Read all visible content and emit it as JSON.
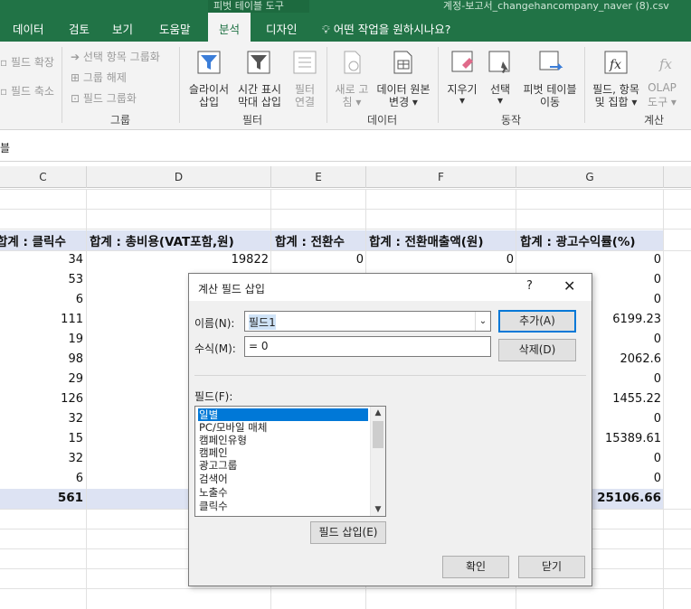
{
  "ribbon": {
    "context_title": "피벗 테이블 도구",
    "file_title": "계정-보고서_changehancompany_naver (8).csv",
    "tabs": [
      "데이터",
      "검토",
      "보기",
      "도움말",
      "분석",
      "디자인"
    ],
    "active_tab": "분석",
    "tell_me": "어떤 작업을 원하시나요?",
    "left_items": {
      "expand": "필드 확장",
      "collapse": "필드 축소"
    },
    "group_group": {
      "label": "그룹",
      "items": [
        "선택 항목 그룹화",
        "그룹 해제",
        "필드 그룹화"
      ]
    },
    "filter_group": {
      "label": "필터",
      "slicer": [
        "슬라이서",
        "삽입"
      ],
      "timeline": [
        "시간 표시",
        "막대 삽입"
      ],
      "filter_conn": [
        "필터",
        "연결"
      ]
    },
    "data_group": {
      "label": "데이터",
      "refresh": [
        "새로 고",
        "침 ▾"
      ],
      "change_source": [
        "데이터 원본",
        "변경 ▾"
      ]
    },
    "actions_group": {
      "label": "동작",
      "clear": [
        "지우기",
        "▾"
      ],
      "select": [
        "선택",
        "▾"
      ],
      "move": [
        "피벗 테이블",
        "이동"
      ]
    },
    "calc_group": {
      "label": "계산",
      "fields": [
        "필드, 항목",
        "및 집합 ▾"
      ],
      "olap": [
        "OLAP",
        "도구 ▾"
      ]
    }
  },
  "namebox_partial": "블",
  "columns": [
    "C",
    "D",
    "E",
    "F",
    "G"
  ],
  "pivot": {
    "headers": [
      "합계 : 클릭수",
      "합계 : 총비용(VAT포함,원)",
      "합계 : 전환수",
      "합계 : 전환매출액(원)",
      "합계 : 광고수익률(%)"
    ],
    "first_row": {
      "clicks": "34",
      "cost": "19822",
      "conv": "0",
      "revenue": "0",
      "roas": "0"
    },
    "clicks": [
      "53",
      "6",
      "111",
      "19",
      "98",
      "29",
      "126",
      "32",
      "15",
      "32",
      "6"
    ],
    "roas": [
      "0",
      "0",
      "6199.23",
      "0",
      "2062.6",
      "0",
      "1455.22",
      "0",
      "15389.61",
      "0",
      "0"
    ],
    "total_clicks": "561",
    "total_roas": "25106.66"
  },
  "dialog": {
    "title": "계산 필드 삽입",
    "help": "?",
    "close": "✕",
    "name_label": "이름(N):",
    "name_value": "필드1",
    "formula_label": "수식(M):",
    "formula_value": "= 0",
    "add_button": "추가(A)",
    "delete_button": "삭제(D)",
    "fields_label": "필드(F):",
    "fields": [
      "일별",
      "PC/모바일 매체",
      "캠페인유형",
      "캠페인",
      "광고그룹",
      "검색어",
      "노출수",
      "클릭수"
    ],
    "selected_field": "일별",
    "insert_field_button": "필드 삽입(E)",
    "ok_button": "확인",
    "close_button": "닫기"
  }
}
